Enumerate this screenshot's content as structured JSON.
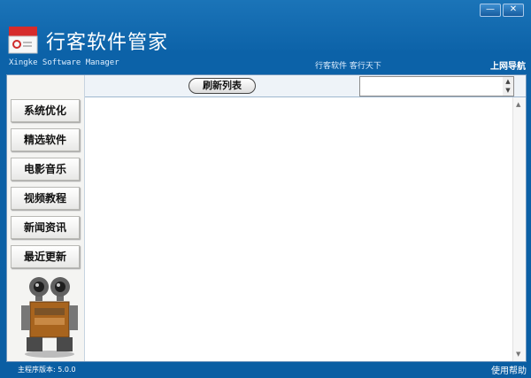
{
  "app": {
    "title": "行客软件管家",
    "subtitle": "Xingke Software Manager",
    "slogan": "行客软件 客行天下"
  },
  "window_controls": {
    "minimize": "—",
    "close": "✕"
  },
  "header": {
    "nav_link": "上网导航"
  },
  "sidebar": {
    "items": [
      {
        "label": "系统优化"
      },
      {
        "label": "精选软件"
      },
      {
        "label": "电影音乐"
      },
      {
        "label": "视频教程"
      },
      {
        "label": "新闻资讯"
      },
      {
        "label": "最近更新"
      }
    ]
  },
  "toolbar": {
    "refresh_label": "刷新列表",
    "combo_value": ""
  },
  "status": {
    "version": "主程序版本: 5.0.0",
    "help": "使用帮助"
  },
  "colors": {
    "window_blue": "#0c62a8",
    "sidebar_bg": "#f4f4f2"
  },
  "icons": {
    "logo": "app-box-icon",
    "mascot": "robot-mascot-icon"
  }
}
